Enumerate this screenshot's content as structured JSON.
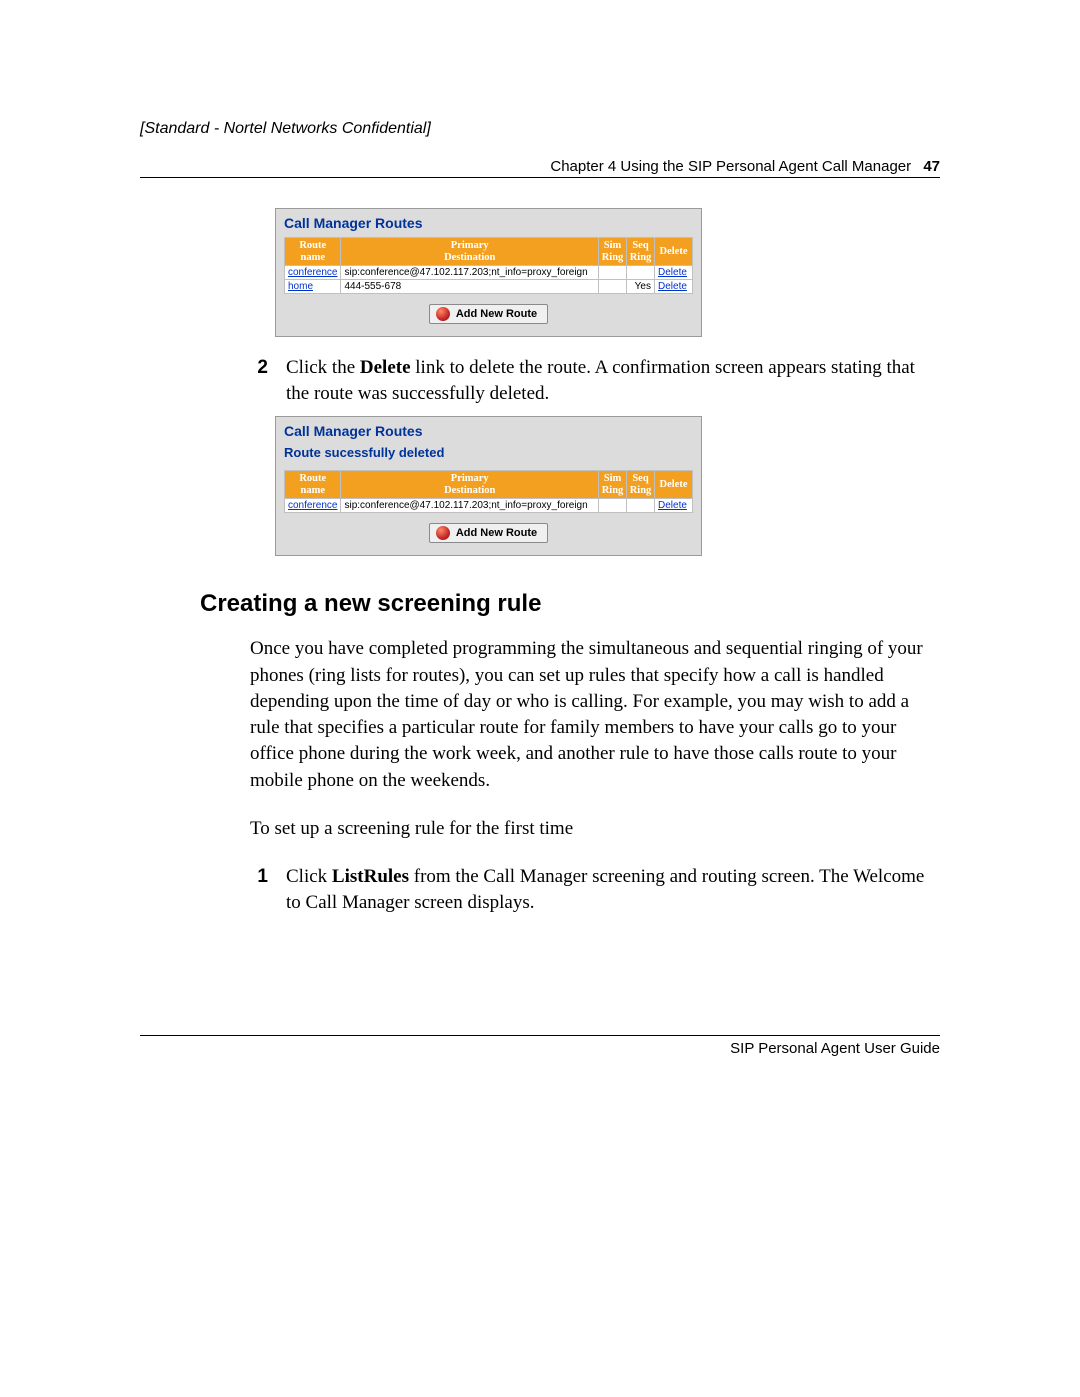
{
  "confidential": "[Standard - Nortel Networks Confidential]",
  "header": {
    "chapter": "Chapter 4  Using the SIP Personal Agent Call Manager",
    "page": "47"
  },
  "footer": "SIP Personal Agent User Guide",
  "panel1": {
    "title": "Call Manager Routes",
    "headers": {
      "route_name_l1": "Route",
      "route_name_l2": "name",
      "primary_l1": "Primary",
      "primary_l2": "Destination",
      "sim_l1": "Sim",
      "sim_l2": "Ring",
      "seq_l1": "Seq",
      "seq_l2": "Ring",
      "delete": "Delete"
    },
    "rows": [
      {
        "name": "conference",
        "dest": "sip:conference@47.102.117.203;nt_info=proxy_foreign",
        "sim": "",
        "seq": "",
        "del": "Delete"
      },
      {
        "name": "home",
        "dest": "444-555-678",
        "sim": "",
        "seq": "Yes",
        "del": "Delete"
      }
    ],
    "add_btn": "Add New Route"
  },
  "step2": {
    "num": "2",
    "pre": "Click the ",
    "bold": "Delete",
    "post": " link to delete the route. A confirmation screen appears stating that the route was successfully deleted."
  },
  "panel2": {
    "title": "Call Manager Routes",
    "subtitle": "Route sucessfully deleted",
    "headers": {
      "route_name_l1": "Route",
      "route_name_l2": "name",
      "primary_l1": "Primary",
      "primary_l2": "Destination",
      "sim_l1": "Sim",
      "sim_l2": "Ring",
      "seq_l1": "Seq",
      "seq_l2": "Ring",
      "delete": "Delete"
    },
    "rows": [
      {
        "name": "conference",
        "dest": "sip:conference@47.102.117.203;nt_info=proxy_foreign",
        "sim": "",
        "seq": "",
        "del": "Delete"
      }
    ],
    "add_btn": "Add New Route"
  },
  "section_heading": "Creating a new screening rule",
  "para1": "Once you have completed programming the simultaneous and sequential ringing of your phones (ring lists for routes), you can set up rules that specify how a call is handled depending upon the time of day or who is calling. For example, you may wish to add a rule that specifies a particular route for family members to have your calls go to your office phone during the work week, and another rule to have those calls route to your mobile phone on the weekends.",
  "para2": "To set up a screening rule for the first time",
  "step1b": {
    "num": "1",
    "pre": "Click ",
    "bold": "ListRules",
    "post": " from the Call Manager screening and routing screen. The Welcome to Call Manager screen displays."
  }
}
